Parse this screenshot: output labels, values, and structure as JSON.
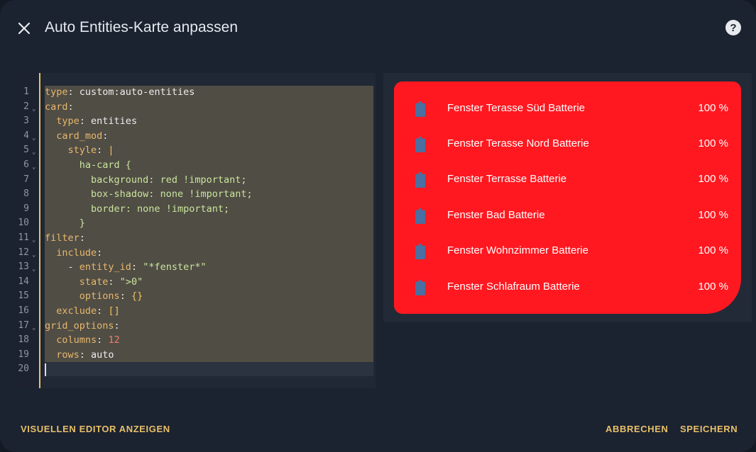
{
  "dialog": {
    "title": "Auto Entities-Karte anpassen",
    "close_icon": "close-icon",
    "help_icon": "help-circle-icon"
  },
  "editor": {
    "lines": [
      {
        "n": "1",
        "fold": "",
        "tokens": [
          [
            "k",
            "type"
          ],
          [
            "p",
            ": "
          ],
          [
            "v",
            "custom:auto-entities"
          ]
        ]
      },
      {
        "n": "2",
        "fold": "⌄",
        "tokens": [
          [
            "k",
            "card"
          ],
          [
            "p",
            ":"
          ]
        ]
      },
      {
        "n": "3",
        "fold": "",
        "tokens": [
          [
            "p",
            "  "
          ],
          [
            "k",
            "type"
          ],
          [
            "p",
            ": "
          ],
          [
            "v",
            "entities"
          ]
        ]
      },
      {
        "n": "4",
        "fold": "⌄",
        "tokens": [
          [
            "p",
            "  "
          ],
          [
            "k",
            "card_mod"
          ],
          [
            "p",
            ":"
          ]
        ]
      },
      {
        "n": "5",
        "fold": "⌄",
        "tokens": [
          [
            "p",
            "    "
          ],
          [
            "k",
            "style"
          ],
          [
            "p",
            ": "
          ],
          [
            "b",
            "|"
          ]
        ]
      },
      {
        "n": "6",
        "fold": "⌄",
        "tokens": [
          [
            "p",
            "      "
          ],
          [
            "s",
            "ha-card {"
          ]
        ]
      },
      {
        "n": "7",
        "fold": "",
        "tokens": [
          [
            "p",
            "        "
          ],
          [
            "s",
            "background: red !important;"
          ]
        ]
      },
      {
        "n": "8",
        "fold": "",
        "tokens": [
          [
            "p",
            "        "
          ],
          [
            "s",
            "box-shadow: none !important;"
          ]
        ]
      },
      {
        "n": "9",
        "fold": "",
        "tokens": [
          [
            "p",
            "        "
          ],
          [
            "s",
            "border: none !important;"
          ]
        ]
      },
      {
        "n": "10",
        "fold": "",
        "tokens": [
          [
            "p",
            "      "
          ],
          [
            "s",
            "}"
          ]
        ]
      },
      {
        "n": "11",
        "fold": "⌄",
        "tokens": [
          [
            "k",
            "filter"
          ],
          [
            "p",
            ":"
          ]
        ]
      },
      {
        "n": "12",
        "fold": "⌄",
        "tokens": [
          [
            "p",
            "  "
          ],
          [
            "k",
            "include"
          ],
          [
            "p",
            ":"
          ]
        ]
      },
      {
        "n": "13",
        "fold": "⌄",
        "tokens": [
          [
            "p",
            "    - "
          ],
          [
            "k",
            "entity_id"
          ],
          [
            "p",
            ": "
          ],
          [
            "s",
            "\"*fenster*\""
          ]
        ]
      },
      {
        "n": "14",
        "fold": "",
        "tokens": [
          [
            "p",
            "      "
          ],
          [
            "k",
            "state"
          ],
          [
            "p",
            ": "
          ],
          [
            "s",
            "\">0\""
          ]
        ]
      },
      {
        "n": "15",
        "fold": "",
        "tokens": [
          [
            "p",
            "      "
          ],
          [
            "k",
            "options"
          ],
          [
            "p",
            ": "
          ],
          [
            "b",
            "{}"
          ]
        ]
      },
      {
        "n": "16",
        "fold": "",
        "tokens": [
          [
            "p",
            "  "
          ],
          [
            "k",
            "exclude"
          ],
          [
            "p",
            ": "
          ],
          [
            "b",
            "[]"
          ]
        ]
      },
      {
        "n": "17",
        "fold": "⌄",
        "tokens": [
          [
            "k",
            "grid_options"
          ],
          [
            "p",
            ":"
          ]
        ]
      },
      {
        "n": "18",
        "fold": "",
        "tokens": [
          [
            "p",
            "  "
          ],
          [
            "k",
            "columns"
          ],
          [
            "p",
            ": "
          ],
          [
            "n",
            "12"
          ]
        ]
      },
      {
        "n": "19",
        "fold": "",
        "tokens": [
          [
            "p",
            "  "
          ],
          [
            "k",
            "rows"
          ],
          [
            "p",
            ": "
          ],
          [
            "v",
            "auto"
          ]
        ]
      },
      {
        "n": "20",
        "fold": "",
        "tokens": []
      }
    ]
  },
  "preview": {
    "card_background": "#ff1820",
    "icon": "battery-icon",
    "entities": [
      {
        "name": "Fenster Terasse Süd Batterie",
        "state": "100 %"
      },
      {
        "name": "Fenster Terasse Nord Batterie",
        "state": "100 %"
      },
      {
        "name": "Fenster Terrasse Batterie",
        "state": "100 %"
      },
      {
        "name": "Fenster Bad Batterie",
        "state": "100 %"
      },
      {
        "name": "Fenster Wohnzimmer Batterie",
        "state": "100 %"
      },
      {
        "name": "Fenster Schlafraum Batterie",
        "state": "100 %"
      }
    ]
  },
  "footer": {
    "visual_editor_label": "VISUELLEN EDITOR ANZEIGEN",
    "cancel_label": "ABBRECHEN",
    "save_label": "SPEICHERN"
  },
  "colors": {
    "accent": "#e8c06a",
    "dialog_bg": "#1b2230",
    "battery_icon": "#4a6fa0"
  }
}
